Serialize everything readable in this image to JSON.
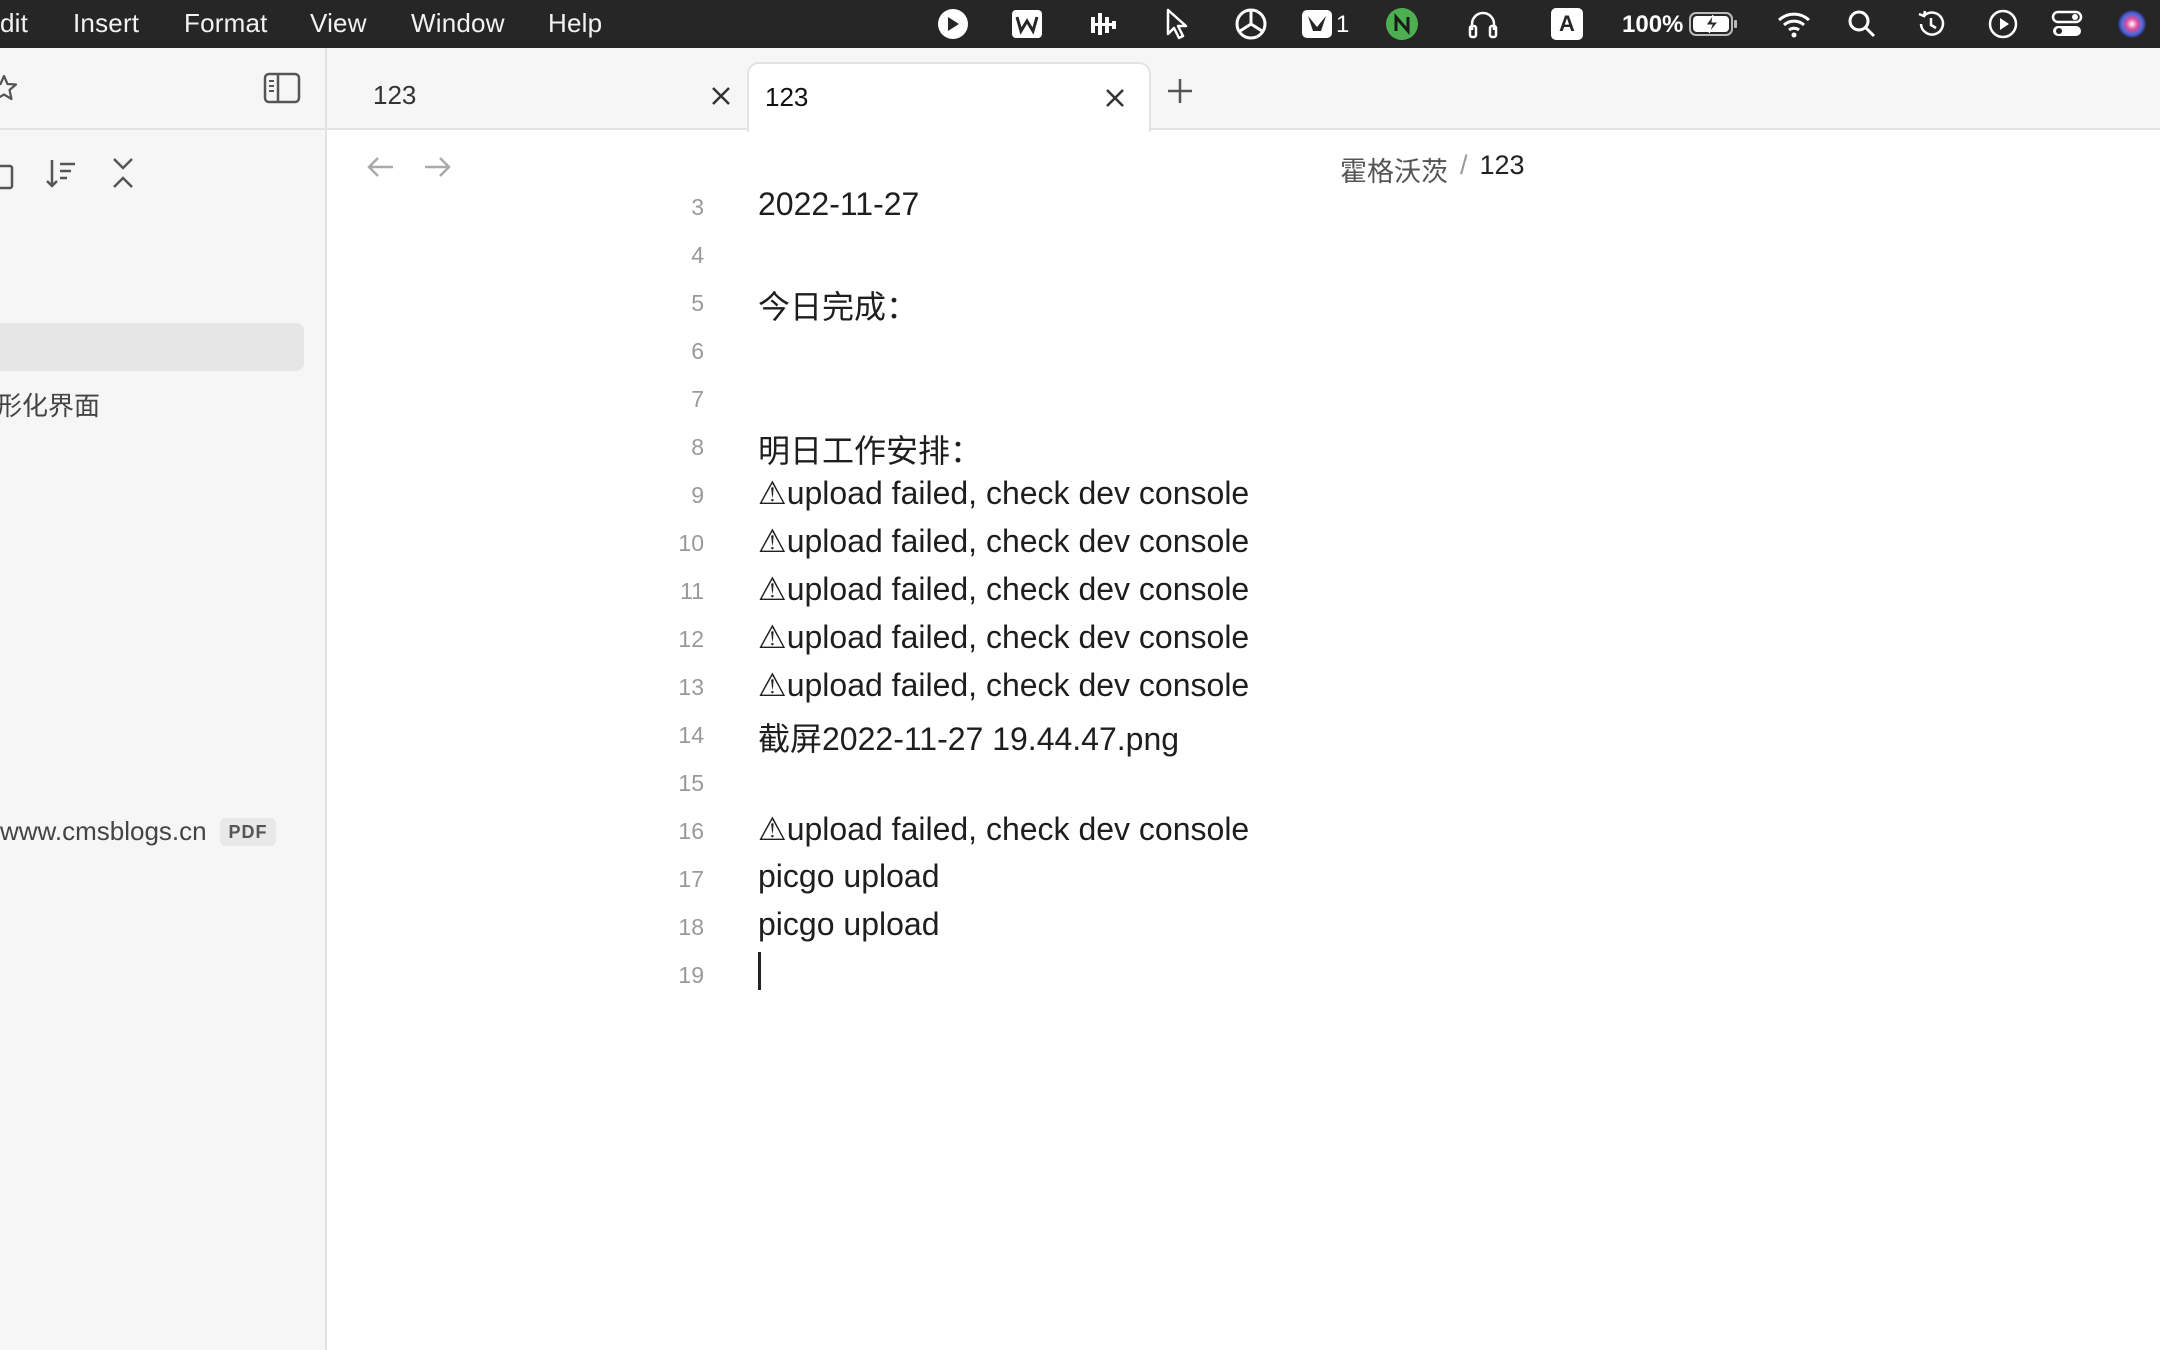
{
  "menubar": {
    "items": [
      "dit",
      "Insert",
      "Format",
      "View",
      "Window",
      "Help"
    ],
    "notification_count": "1",
    "battery": "100%",
    "status_icons": [
      "pen-icon",
      "wps-icon",
      "tracker-icon",
      "cursor-icon",
      "perplexity-icon",
      "app-badge-icon",
      "n-icon",
      "headphones-icon",
      "input-method-icon",
      "battery-icon",
      "wifi-icon",
      "search-icon",
      "time-machine-icon",
      "play-icon",
      "control-center-icon",
      "siri-icon"
    ],
    "input_method_letter": "A"
  },
  "sidebar": {
    "file_item": "图形化界面",
    "file_item_visible": "形化界面",
    "pdf_item": "www.cmsblogs.cn",
    "pdf_badge": "PDF"
  },
  "tabs": [
    {
      "title": "123",
      "active": false
    },
    {
      "title": "123",
      "active": true
    }
  ],
  "breadcrumb": {
    "folder": "霍格沃茨",
    "separator": "/",
    "note": "123"
  },
  "editor": {
    "lines": [
      {
        "num": "3",
        "text": "2022-11-27"
      },
      {
        "num": "4",
        "text": ""
      },
      {
        "num": "5",
        "text": "今日完成："
      },
      {
        "num": "6",
        "text": ""
      },
      {
        "num": "7",
        "text": ""
      },
      {
        "num": "8",
        "text": "明日工作安排："
      },
      {
        "num": "9",
        "text": "⚠upload failed, check dev console"
      },
      {
        "num": "10",
        "text": "⚠upload failed, check dev console"
      },
      {
        "num": "11",
        "text": "⚠upload failed, check dev console"
      },
      {
        "num": "12",
        "text": "⚠upload failed, check dev console"
      },
      {
        "num": "13",
        "text": "⚠upload failed, check dev console"
      },
      {
        "num": "14",
        "text": "截屏2022-11-27 19.44.47.png"
      },
      {
        "num": "15",
        "text": ""
      },
      {
        "num": "16",
        "text": "⚠upload failed, check dev console"
      },
      {
        "num": "17",
        "text": "picgo upload"
      },
      {
        "num": "18",
        "text": "picgo upload"
      },
      {
        "num": "19",
        "text": ""
      }
    ]
  }
}
